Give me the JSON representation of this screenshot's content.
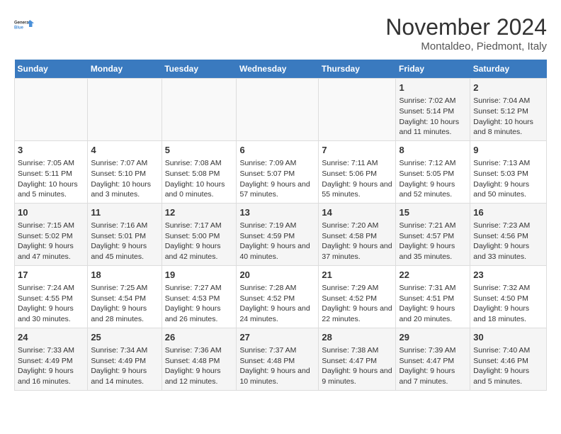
{
  "logo": {
    "line1": "General",
    "line2": "Blue"
  },
  "title": "November 2024",
  "subtitle": "Montaldeo, Piedmont, Italy",
  "days_of_week": [
    "Sunday",
    "Monday",
    "Tuesday",
    "Wednesday",
    "Thursday",
    "Friday",
    "Saturday"
  ],
  "weeks": [
    [
      {
        "day": "",
        "info": ""
      },
      {
        "day": "",
        "info": ""
      },
      {
        "day": "",
        "info": ""
      },
      {
        "day": "",
        "info": ""
      },
      {
        "day": "",
        "info": ""
      },
      {
        "day": "1",
        "info": "Sunrise: 7:02 AM\nSunset: 5:14 PM\nDaylight: 10 hours and 11 minutes."
      },
      {
        "day": "2",
        "info": "Sunrise: 7:04 AM\nSunset: 5:12 PM\nDaylight: 10 hours and 8 minutes."
      }
    ],
    [
      {
        "day": "3",
        "info": "Sunrise: 7:05 AM\nSunset: 5:11 PM\nDaylight: 10 hours and 5 minutes."
      },
      {
        "day": "4",
        "info": "Sunrise: 7:07 AM\nSunset: 5:10 PM\nDaylight: 10 hours and 3 minutes."
      },
      {
        "day": "5",
        "info": "Sunrise: 7:08 AM\nSunset: 5:08 PM\nDaylight: 10 hours and 0 minutes."
      },
      {
        "day": "6",
        "info": "Sunrise: 7:09 AM\nSunset: 5:07 PM\nDaylight: 9 hours and 57 minutes."
      },
      {
        "day": "7",
        "info": "Sunrise: 7:11 AM\nSunset: 5:06 PM\nDaylight: 9 hours and 55 minutes."
      },
      {
        "day": "8",
        "info": "Sunrise: 7:12 AM\nSunset: 5:05 PM\nDaylight: 9 hours and 52 minutes."
      },
      {
        "day": "9",
        "info": "Sunrise: 7:13 AM\nSunset: 5:03 PM\nDaylight: 9 hours and 50 minutes."
      }
    ],
    [
      {
        "day": "10",
        "info": "Sunrise: 7:15 AM\nSunset: 5:02 PM\nDaylight: 9 hours and 47 minutes."
      },
      {
        "day": "11",
        "info": "Sunrise: 7:16 AM\nSunset: 5:01 PM\nDaylight: 9 hours and 45 minutes."
      },
      {
        "day": "12",
        "info": "Sunrise: 7:17 AM\nSunset: 5:00 PM\nDaylight: 9 hours and 42 minutes."
      },
      {
        "day": "13",
        "info": "Sunrise: 7:19 AM\nSunset: 4:59 PM\nDaylight: 9 hours and 40 minutes."
      },
      {
        "day": "14",
        "info": "Sunrise: 7:20 AM\nSunset: 4:58 PM\nDaylight: 9 hours and 37 minutes."
      },
      {
        "day": "15",
        "info": "Sunrise: 7:21 AM\nSunset: 4:57 PM\nDaylight: 9 hours and 35 minutes."
      },
      {
        "day": "16",
        "info": "Sunrise: 7:23 AM\nSunset: 4:56 PM\nDaylight: 9 hours and 33 minutes."
      }
    ],
    [
      {
        "day": "17",
        "info": "Sunrise: 7:24 AM\nSunset: 4:55 PM\nDaylight: 9 hours and 30 minutes."
      },
      {
        "day": "18",
        "info": "Sunrise: 7:25 AM\nSunset: 4:54 PM\nDaylight: 9 hours and 28 minutes."
      },
      {
        "day": "19",
        "info": "Sunrise: 7:27 AM\nSunset: 4:53 PM\nDaylight: 9 hours and 26 minutes."
      },
      {
        "day": "20",
        "info": "Sunrise: 7:28 AM\nSunset: 4:52 PM\nDaylight: 9 hours and 24 minutes."
      },
      {
        "day": "21",
        "info": "Sunrise: 7:29 AM\nSunset: 4:52 PM\nDaylight: 9 hours and 22 minutes."
      },
      {
        "day": "22",
        "info": "Sunrise: 7:31 AM\nSunset: 4:51 PM\nDaylight: 9 hours and 20 minutes."
      },
      {
        "day": "23",
        "info": "Sunrise: 7:32 AM\nSunset: 4:50 PM\nDaylight: 9 hours and 18 minutes."
      }
    ],
    [
      {
        "day": "24",
        "info": "Sunrise: 7:33 AM\nSunset: 4:49 PM\nDaylight: 9 hours and 16 minutes."
      },
      {
        "day": "25",
        "info": "Sunrise: 7:34 AM\nSunset: 4:49 PM\nDaylight: 9 hours and 14 minutes."
      },
      {
        "day": "26",
        "info": "Sunrise: 7:36 AM\nSunset: 4:48 PM\nDaylight: 9 hours and 12 minutes."
      },
      {
        "day": "27",
        "info": "Sunrise: 7:37 AM\nSunset: 4:48 PM\nDaylight: 9 hours and 10 minutes."
      },
      {
        "day": "28",
        "info": "Sunrise: 7:38 AM\nSunset: 4:47 PM\nDaylight: 9 hours and 9 minutes."
      },
      {
        "day": "29",
        "info": "Sunrise: 7:39 AM\nSunset: 4:47 PM\nDaylight: 9 hours and 7 minutes."
      },
      {
        "day": "30",
        "info": "Sunrise: 7:40 AM\nSunset: 4:46 PM\nDaylight: 9 hours and 5 minutes."
      }
    ]
  ]
}
